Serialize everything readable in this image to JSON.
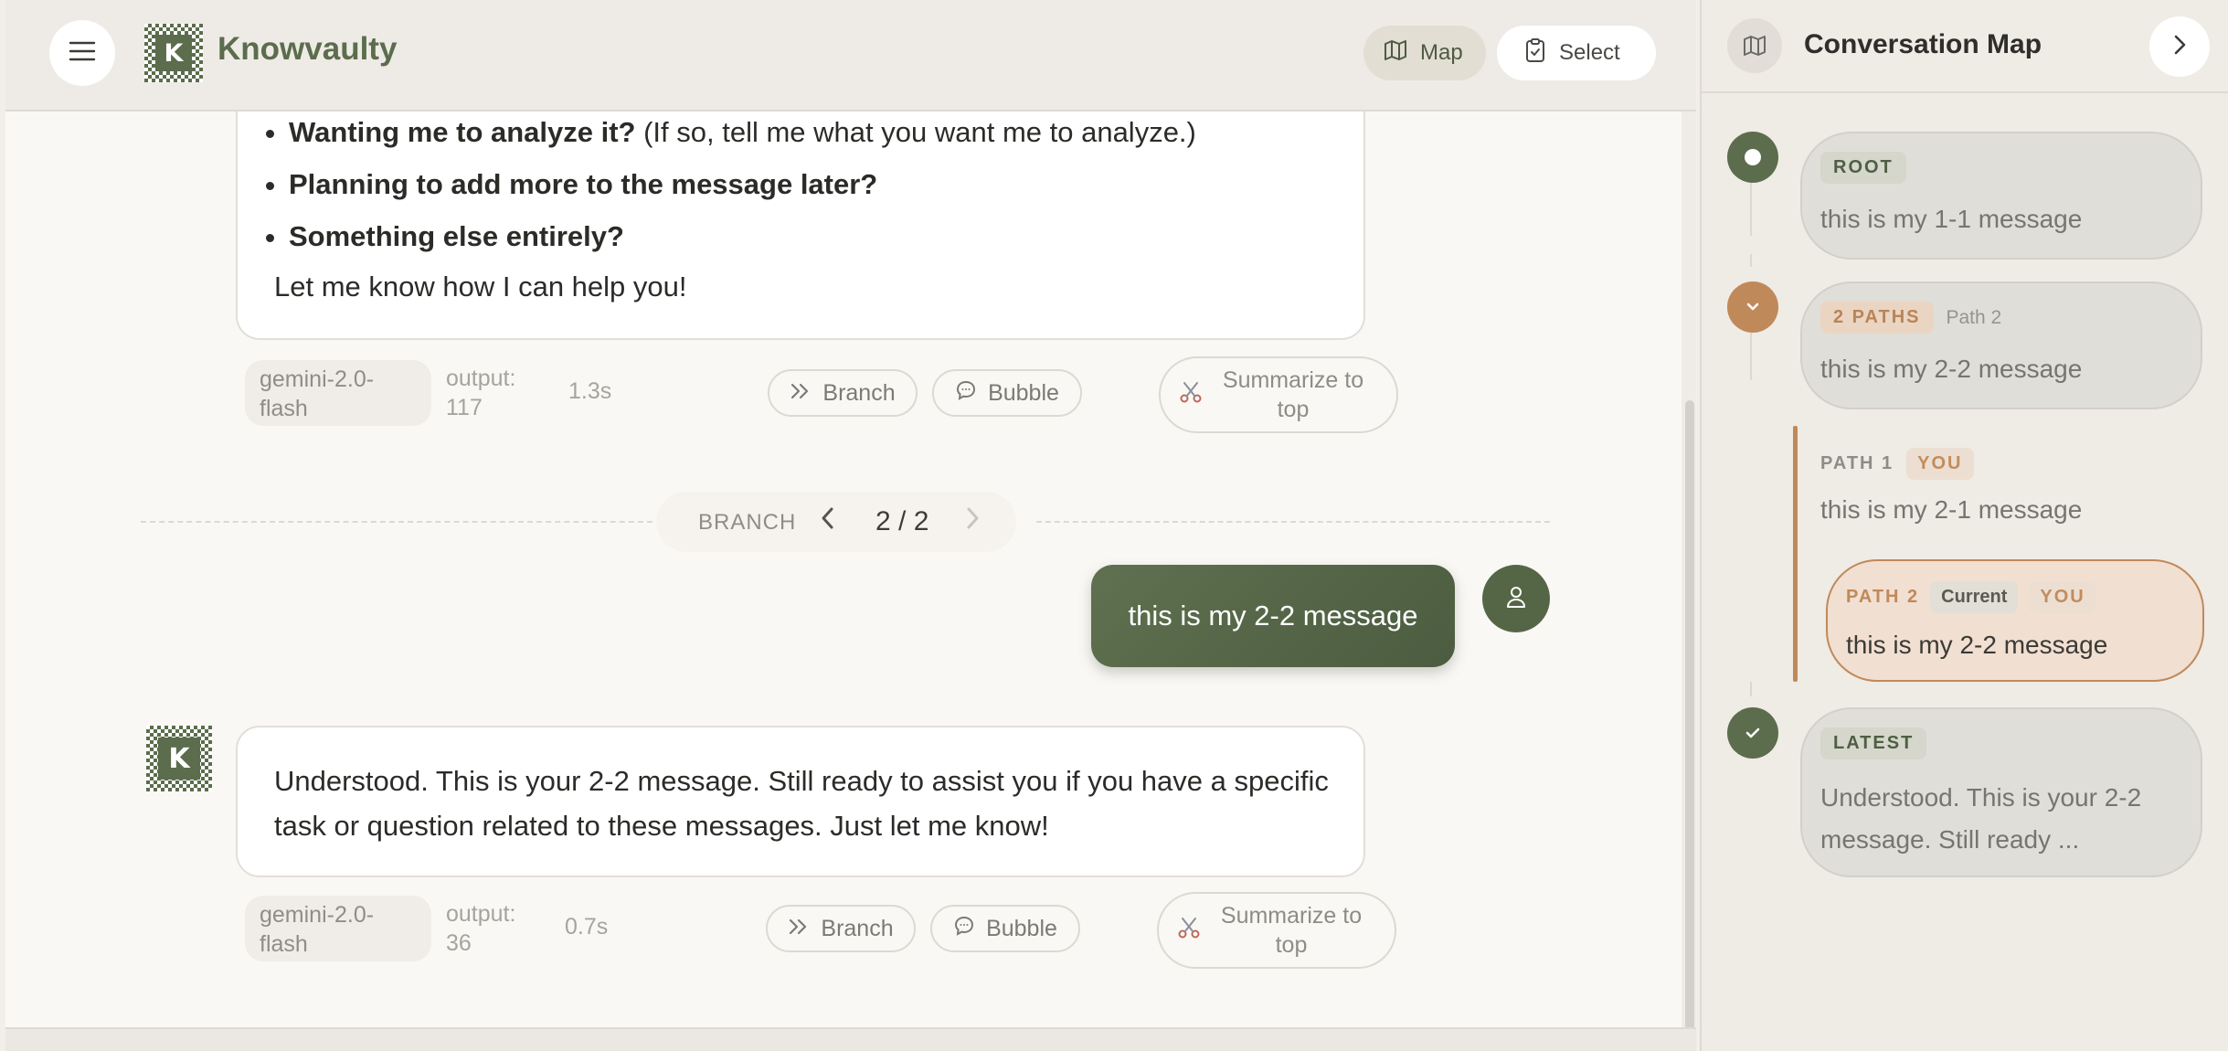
{
  "app": {
    "brand": "Knowvaulty",
    "logo_letter": "K"
  },
  "toolbar": {
    "map_label": "Map",
    "select_label": "Select"
  },
  "messages": {
    "first_ai": {
      "bullets": [
        {
          "bold": "Wanting me to analyze it?",
          "rest": " (If so, tell me what you want me to analyze.)"
        },
        {
          "bold": "Planning to add more to the message later?",
          "rest": ""
        },
        {
          "bold": "Something else entirely?",
          "rest": ""
        }
      ],
      "closing": "Let me know how I can help you!",
      "meta": {
        "model": "gemini-2.0-flash",
        "output": "output: 117",
        "time": "1.3s",
        "branch_label": "Branch",
        "bubble_label": "Bubble",
        "summarize_label": "Summarize to top"
      }
    },
    "branch_nav": {
      "label": "BRANCH",
      "prev": "‹",
      "count": "2 / 2",
      "next": "›"
    },
    "user": {
      "text": "this is my 2-2 message"
    },
    "second_ai": {
      "text": "Understood. This is your 2-2 message. Still ready to assist you if you have a specific task or question related to these messages. Just let me know!",
      "meta": {
        "model": "gemini-2.0-flash",
        "output": "output: 36",
        "time": "0.7s",
        "branch_label": "Branch",
        "bubble_label": "Bubble",
        "summarize_label": "Summarize to top"
      }
    }
  },
  "map_panel": {
    "title": "Conversation Map",
    "root": {
      "tag": "ROOT",
      "text": "this is my 1-1 message"
    },
    "fork": {
      "tag": "2 PATHS",
      "sub": "Path 2",
      "text": "this is my 2-2 message"
    },
    "path1": {
      "label": "PATH 1",
      "you": "YOU",
      "text": "this is my 2-1 message"
    },
    "path2": {
      "label": "PATH 2",
      "current": "Current",
      "you": "YOU",
      "text": "this is my 2-2 message"
    },
    "latest": {
      "tag": "LATEST",
      "text": "Understood. This is your 2-2 message. Still ready ..."
    }
  },
  "colors": {
    "accent_green": "#5b6d4c",
    "accent_orange": "#c0895a"
  }
}
